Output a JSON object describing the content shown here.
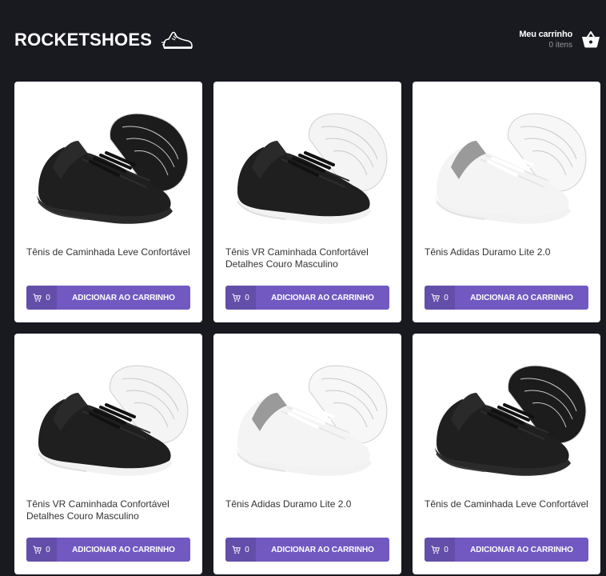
{
  "header": {
    "logo_text": "ROCKETSHOES",
    "cart_title": "Meu carrinho",
    "cart_count": "0 itens"
  },
  "colors": {
    "background": "#191920",
    "accent": "#7159c1",
    "card": "#ffffff"
  },
  "products": [
    {
      "title": "Tênis de Caminhada Leve Confortável",
      "amount": "0",
      "button_label": "ADICIONAR AO CARRINHO",
      "shoe_style": "black"
    },
    {
      "title": "Tênis VR Caminhada Confortável Detalhes Couro Masculino",
      "amount": "0",
      "button_label": "ADICIONAR AO CARRINHO",
      "shoe_style": "black-white"
    },
    {
      "title": "Tênis Adidas Duramo Lite 2.0",
      "amount": "0",
      "button_label": "ADICIONAR AO CARRINHO",
      "shoe_style": "white-grey"
    },
    {
      "title": "Tênis VR Caminhada Confortável Detalhes Couro Masculino",
      "amount": "0",
      "button_label": "ADICIONAR AO CARRINHO",
      "shoe_style": "black-white"
    },
    {
      "title": "Tênis Adidas Duramo Lite 2.0",
      "amount": "0",
      "button_label": "ADICIONAR AO CARRINHO",
      "shoe_style": "white-grey"
    },
    {
      "title": "Tênis de Caminhada Leve Confortável",
      "amount": "0",
      "button_label": "ADICIONAR AO CARRINHO",
      "shoe_style": "black"
    }
  ]
}
